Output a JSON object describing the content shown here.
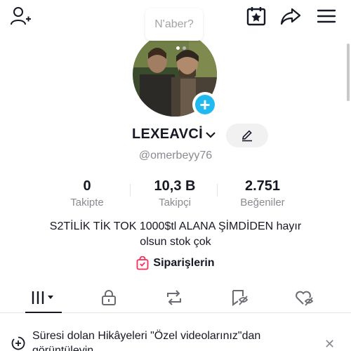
{
  "topbar": {
    "icons": [
      "add-user-icon",
      "calendar-star-icon",
      "share-icon",
      "menu-icon"
    ]
  },
  "profile": {
    "bubble_text": "N'aber?",
    "username": "LEXEAVCİ",
    "handle": "@omerbeyy76",
    "stats": [
      {
        "value": "0",
        "label": "Takipte"
      },
      {
        "value": "10,3 B",
        "label": "Takipçi"
      },
      {
        "value": "2.751",
        "label": "Beğeniler"
      }
    ],
    "bio_line1": "S2TİLİK TİK TOK 1000$tl  ALANA ŞİMDİDEN hayır",
    "bio_line2": "olsun stok çok",
    "orders_label": "Siparişlerin"
  },
  "tabs": [
    "videos-grid-icon",
    "private-lock-icon",
    "repost-icon",
    "favorites-icon",
    "liked-icon"
  ],
  "banner": {
    "text": "Süresi dolan Hikâyeleri \"Özel videolarınız\"dan görüntüleyin",
    "close": "✕"
  },
  "colors": {
    "accent": "#20b9f0",
    "orders_icon": "#fe2c55",
    "text": "#161823",
    "muted": "#8a8b91"
  }
}
